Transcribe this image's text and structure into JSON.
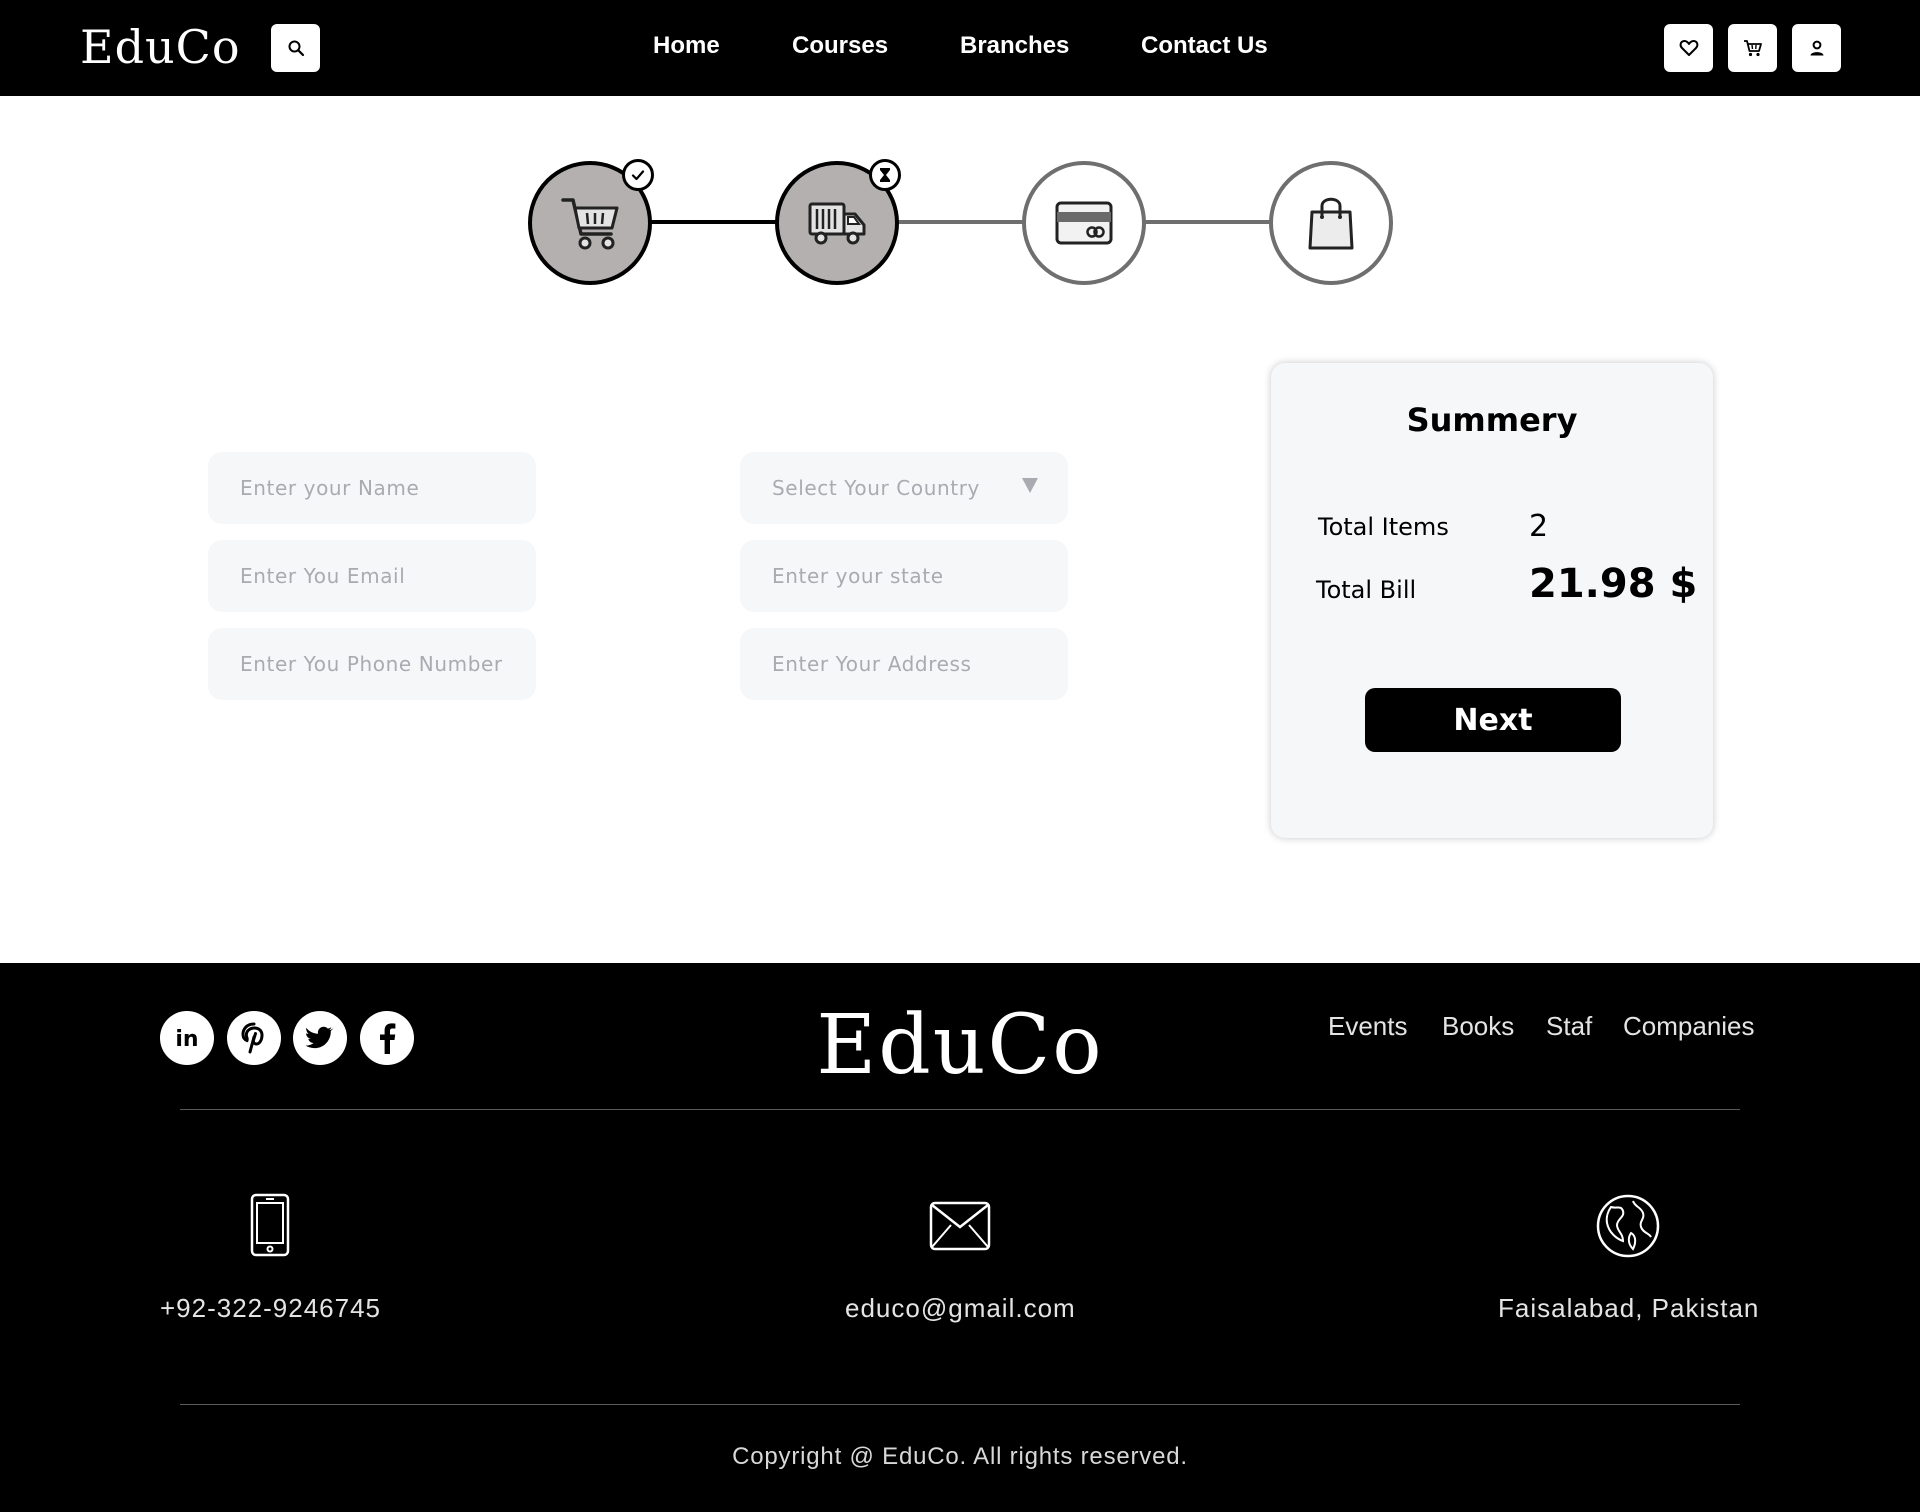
{
  "header": {
    "logo": "EduCo",
    "nav": [
      "Home",
      "Courses",
      "Branches",
      "Contact Us"
    ],
    "icons": [
      "search-icon",
      "heart-icon",
      "cart-icon",
      "user-icon"
    ]
  },
  "stepper": {
    "steps": [
      {
        "icon": "cart-icon",
        "status": "done",
        "badge": "check-icon"
      },
      {
        "icon": "truck-icon",
        "status": "current",
        "badge": "hourglass-icon"
      },
      {
        "icon": "credit-card-icon",
        "status": "pending"
      },
      {
        "icon": "shopping-bag-icon",
        "status": "pending"
      }
    ]
  },
  "form": {
    "name_placeholder": "Enter your Name",
    "email_placeholder": "Enter You Email",
    "phone_placeholder": "Enter You Phone Number",
    "country_select": "Select Your Country",
    "state_placeholder": "Enter your state",
    "address_placeholder": "Enter Your Address"
  },
  "summary": {
    "title": "Summery",
    "items_label": "Total Items",
    "items_value": "2",
    "bill_label": "Total Bill",
    "bill_value": "21.98 $",
    "next_label": "Next"
  },
  "footer": {
    "logo": "EduCo",
    "social": [
      "linkedin-icon",
      "pinterest-icon",
      "twitter-icon",
      "facebook-icon"
    ],
    "links": [
      "Events",
      "Books",
      "Staf",
      "Companies"
    ],
    "phone": "+92-322-9246745",
    "email": "educo@gmail.com",
    "location": "Faisalabad, Pakistan",
    "copyright": "Copyright @ EduCo. All rights reserved."
  },
  "colors": {
    "header_bg": "#000000",
    "step_done_fill": "#b4b0b0",
    "step_pending_border": "#6f6f6f",
    "field_bg": "#f6f7f9",
    "placeholder": "#a9abb0"
  }
}
